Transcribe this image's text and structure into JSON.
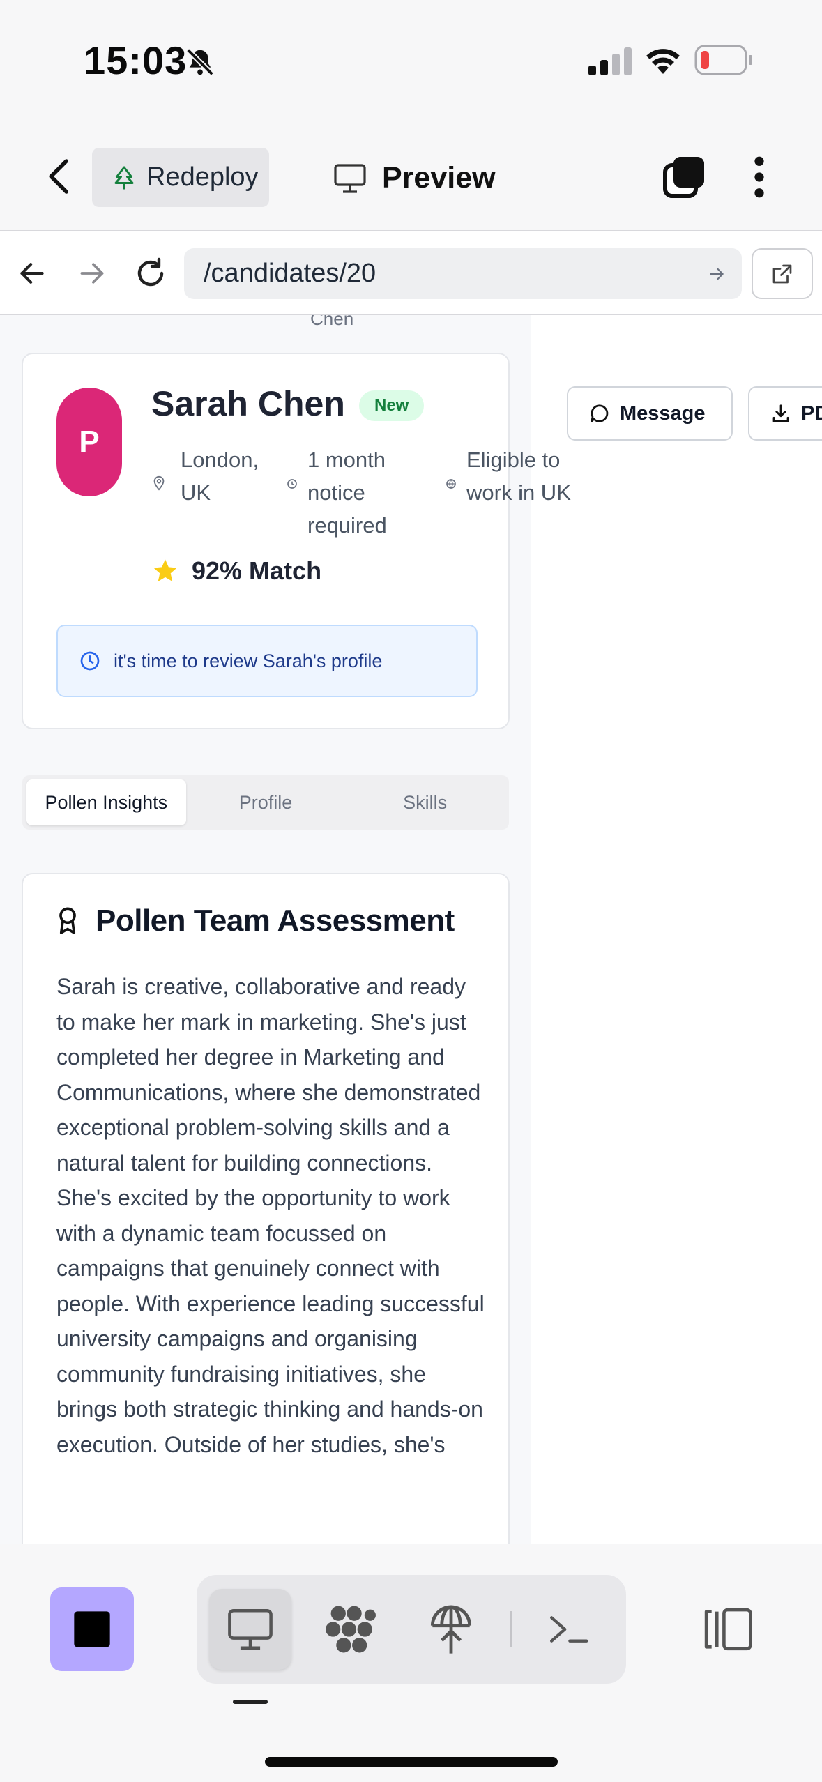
{
  "status_bar": {
    "time": "15:03"
  },
  "header": {
    "redeploy_label": "Redeploy",
    "preview_label": "Preview"
  },
  "browser": {
    "url": "/candidates/20"
  },
  "candidate": {
    "clipped_text": "Chen",
    "avatar_initial": "P",
    "name": "Sarah Chen",
    "badge": "New",
    "location": "London, UK",
    "notice": "1 month notice required",
    "eligibility": "Eligible to work in UK",
    "match": "92% Match",
    "alert": "it's time to review Sarah's profile"
  },
  "actions": {
    "message": "Message",
    "pdf": "PDF"
  },
  "tabs": [
    {
      "label": "Pollen Insights",
      "active": true
    },
    {
      "label": "Profile",
      "active": false
    },
    {
      "label": "Skills",
      "active": false
    }
  ],
  "assessment": {
    "title": "Pollen Team Assessment",
    "body": "Sarah is creative, collaborative and ready to make her mark in marketing. She's just completed her degree in Marketing and Communications, where she demonstrated exceptional problem-solving skills and a natural talent for building connections. She's excited by the opportunity to work with a dynamic team focussed on campaigns that genuinely connect with people. With experience leading successful university campaigns and organising community fundraising initiatives, she brings both strategic thinking and hands-on execution. Outside of her studies, she's"
  },
  "colors": {
    "avatar": "#db2777",
    "stop_button": "#b4a7ff",
    "new_badge": "#dcfce7",
    "star": "#facc15"
  },
  "icons": [
    "bell-slash-icon",
    "signal-icon",
    "wifi-icon",
    "battery-icon",
    "back-chevron-icon",
    "tree-icon",
    "monitor-icon",
    "tabs-icon",
    "more-vertical-icon",
    "arrow-left-icon",
    "arrow-right-icon",
    "reload-icon",
    "go-arrow-icon",
    "external-link-icon",
    "pin-icon",
    "clock-icon",
    "globe-icon",
    "star-icon",
    "award-icon",
    "message-icon",
    "download-icon",
    "stop-icon",
    "monitor-icon",
    "cluster-icon",
    "deploy-icon",
    "terminal-icon",
    "split-view-icon"
  ]
}
